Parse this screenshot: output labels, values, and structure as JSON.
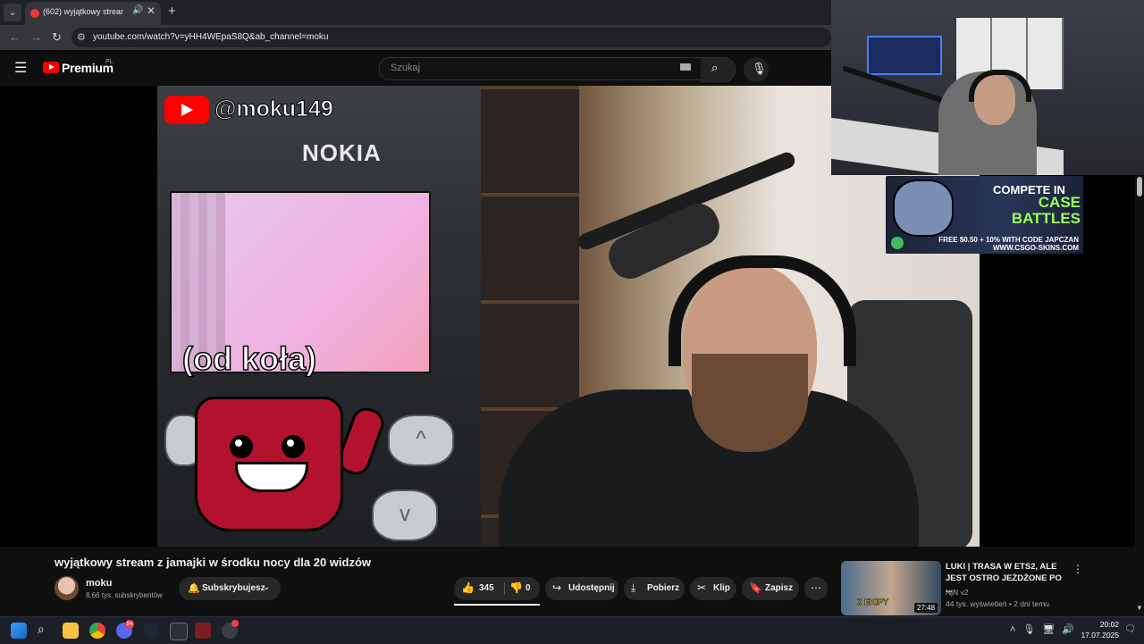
{
  "browser": {
    "tab_title": "(602) wyjątkowy stream z ja...",
    "tab_audio_icon": "speaker-icon",
    "tab_close": "✕",
    "new_tab": "+",
    "url": "youtube.com/watch?v=yHH4WEpaS8Q&ab_channel=moku"
  },
  "masthead": {
    "logo_text": "Premium",
    "region": "PL",
    "search_placeholder": "Szukaj"
  },
  "player": {
    "channel_badge": "@moku149",
    "phone_brand": "NOKIA",
    "caption": "(od koła)"
  },
  "ad": {
    "line1": "COMPETE IN",
    "line2": "CASE BATTLES",
    "offer": "FREE $0.50 + 10% WITH CODE JAPCZAN",
    "site": "WWW.CSGO-SKINS.COM"
  },
  "video": {
    "title": "wyjątkowy stream z jamajki w środku nocy dla 20 widzów",
    "channel_name": "moku",
    "subscribers": "8,66 tys. subskrybentów",
    "subscribe_label": "Subskrybujesz",
    "likes": "345",
    "dislikes": "0",
    "share_label": "Udostępnij",
    "download_label": "Pobierz",
    "clip_label": "Klip",
    "save_label": "Zapisz"
  },
  "recommended": {
    "title": "LUKI | TRASA W ETS2, ALE JEST OSTRO JEŻDŻONE PO ...",
    "channel": "NjN v2",
    "meta": "44 tys. wyświetleń • 2 dni temu",
    "duration": "27:48",
    "thumb_caption": "Z EKIPY"
  },
  "taskbar": {
    "discord_badge": "94",
    "time": "20:02",
    "date": "17.07.2025"
  }
}
